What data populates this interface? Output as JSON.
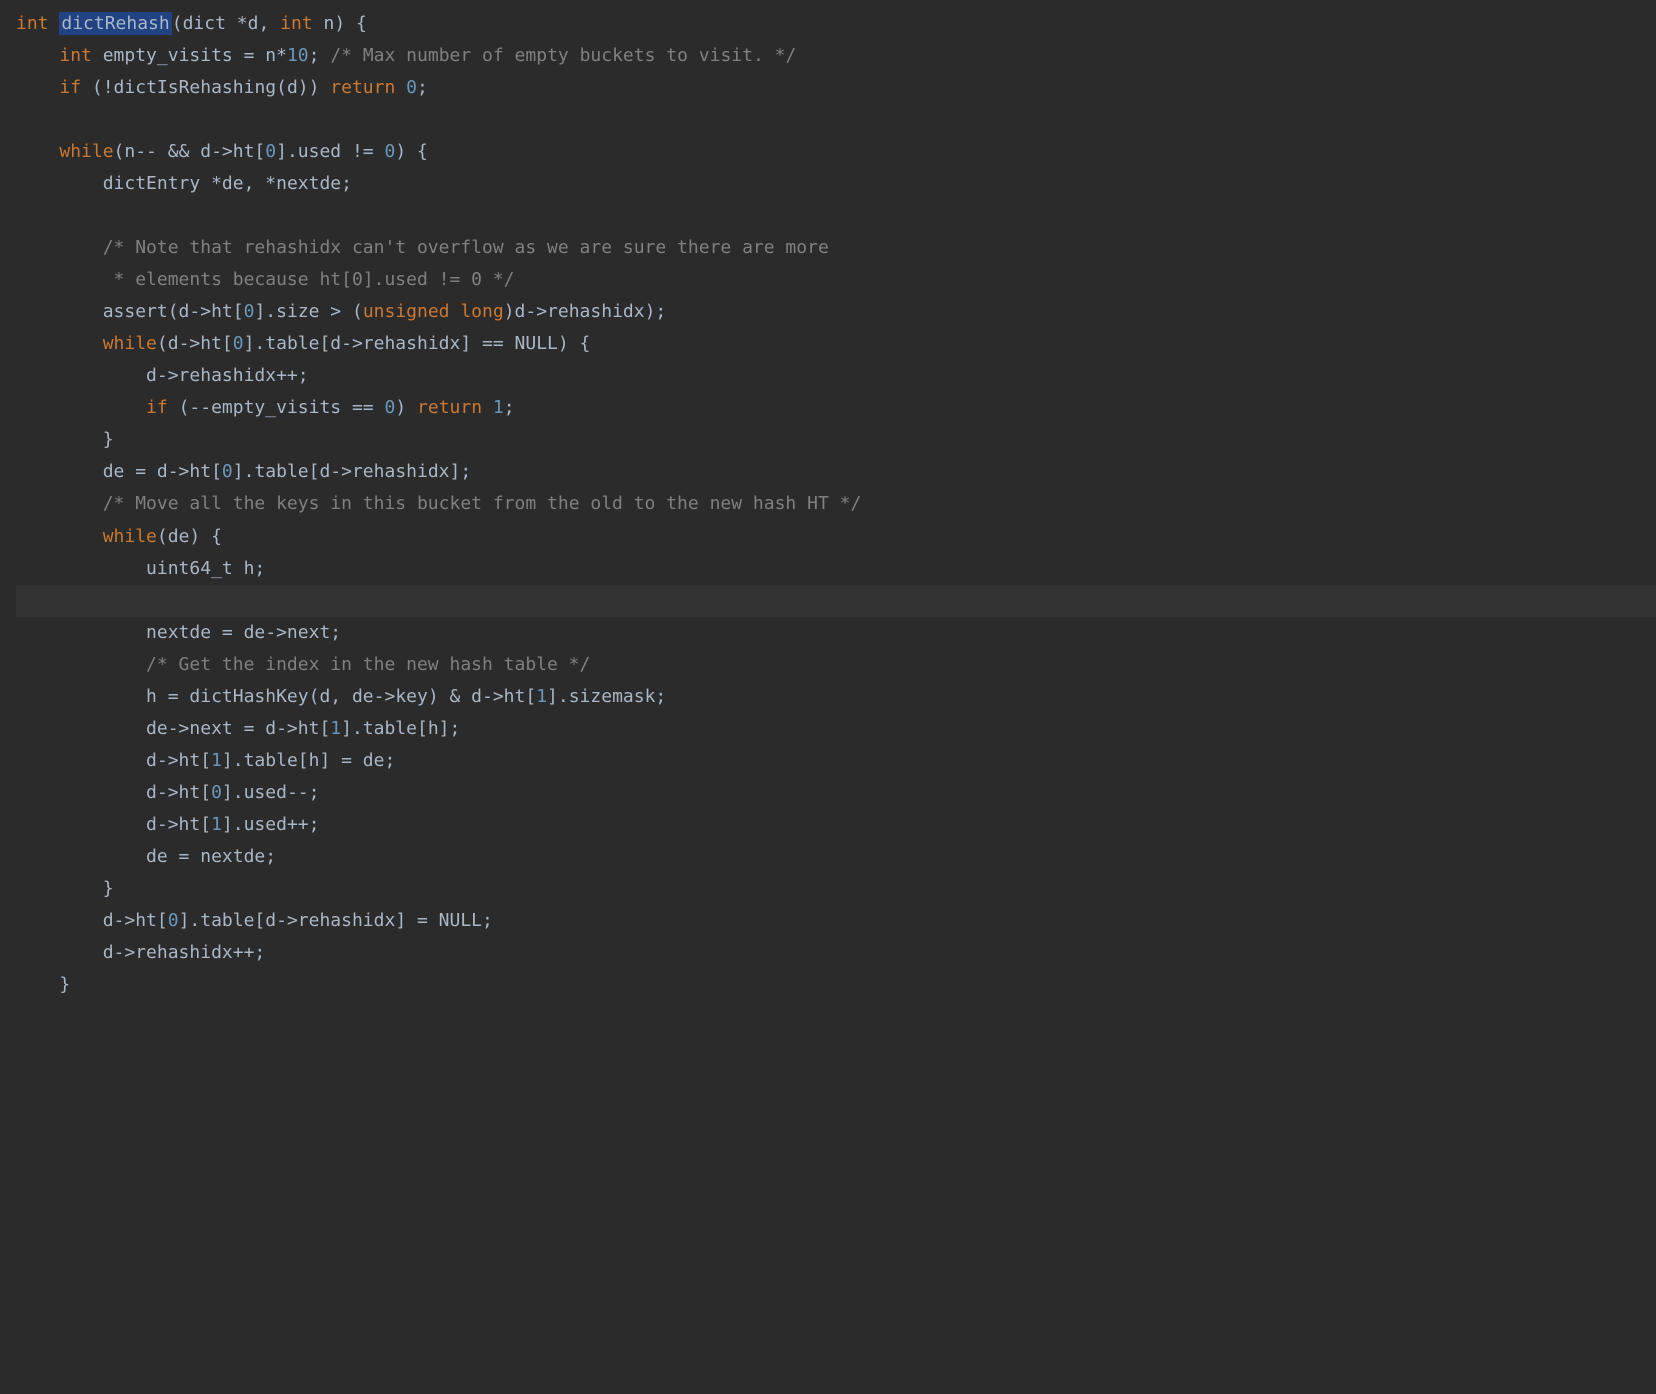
{
  "code": {
    "lines": [
      {
        "indent": 0,
        "spans": [
          {
            "cls": "kw",
            "text": "int"
          },
          {
            "cls": "white",
            "text": " "
          },
          {
            "cls": "highlight-box",
            "text": "dictRehash"
          },
          {
            "cls": "white",
            "text": "(dict *d"
          },
          {
            "cls": "op",
            "text": ", "
          },
          {
            "cls": "kw",
            "text": "int"
          },
          {
            "cls": "white",
            "text": " n) {"
          }
        ]
      },
      {
        "indent": 1,
        "spans": [
          {
            "cls": "kw",
            "text": "int"
          },
          {
            "cls": "white",
            "text": " empty_visits = n*"
          },
          {
            "cls": "num",
            "text": "10"
          },
          {
            "cls": "white",
            "text": "; "
          },
          {
            "cls": "comment",
            "text": "/* Max number of empty buckets to visit. */"
          }
        ]
      },
      {
        "indent": 1,
        "spans": [
          {
            "cls": "kw",
            "text": "if"
          },
          {
            "cls": "white",
            "text": " (!dictIsRehashing(d)) "
          },
          {
            "cls": "kw",
            "text": "return"
          },
          {
            "cls": "white",
            "text": " "
          },
          {
            "cls": "num",
            "text": "0"
          },
          {
            "cls": "white",
            "text": ";"
          }
        ]
      },
      {
        "indent": 0,
        "spans": []
      },
      {
        "indent": 1,
        "spans": [
          {
            "cls": "kw",
            "text": "while"
          },
          {
            "cls": "white",
            "text": "(n-- && d->ht["
          },
          {
            "cls": "num",
            "text": "0"
          },
          {
            "cls": "white",
            "text": "].used != "
          },
          {
            "cls": "num",
            "text": "0"
          },
          {
            "cls": "white",
            "text": ") {"
          }
        ]
      },
      {
        "indent": 2,
        "spans": [
          {
            "cls": "white",
            "text": "dictEntry *de"
          },
          {
            "cls": "op",
            "text": ", "
          },
          {
            "cls": "white",
            "text": "*nextde;"
          }
        ]
      },
      {
        "indent": 0,
        "spans": []
      },
      {
        "indent": 2,
        "spans": [
          {
            "cls": "comment",
            "text": "/* Note that rehashidx can't overflow as we are sure there are more"
          }
        ]
      },
      {
        "indent": 2,
        "spans": [
          {
            "cls": "comment",
            "text": " * elements because ht[0].used != 0 */"
          }
        ]
      },
      {
        "indent": 2,
        "spans": [
          {
            "cls": "white",
            "text": "assert(d->ht["
          },
          {
            "cls": "num",
            "text": "0"
          },
          {
            "cls": "white",
            "text": "].size > ("
          },
          {
            "cls": "kw",
            "text": "unsigned long"
          },
          {
            "cls": "white",
            "text": ")d->rehashidx);"
          }
        ]
      },
      {
        "indent": 2,
        "spans": [
          {
            "cls": "kw",
            "text": "while"
          },
          {
            "cls": "white",
            "text": "(d->ht["
          },
          {
            "cls": "num",
            "text": "0"
          },
          {
            "cls": "white",
            "text": "].table[d->rehashidx] == NULL) {"
          }
        ]
      },
      {
        "indent": 3,
        "spans": [
          {
            "cls": "white",
            "text": "d->rehashidx++;"
          }
        ]
      },
      {
        "indent": 3,
        "spans": [
          {
            "cls": "kw",
            "text": "if"
          },
          {
            "cls": "white",
            "text": " (--empty_visits == "
          },
          {
            "cls": "num",
            "text": "0"
          },
          {
            "cls": "white",
            "text": ") "
          },
          {
            "cls": "kw",
            "text": "return"
          },
          {
            "cls": "white",
            "text": " "
          },
          {
            "cls": "num",
            "text": "1"
          },
          {
            "cls": "white",
            "text": ";"
          }
        ]
      },
      {
        "indent": 2,
        "spans": [
          {
            "cls": "white",
            "text": "}"
          }
        ]
      },
      {
        "indent": 2,
        "spans": [
          {
            "cls": "white",
            "text": "de = d->ht["
          },
          {
            "cls": "num",
            "text": "0"
          },
          {
            "cls": "white",
            "text": "].table[d->rehashidx];"
          }
        ]
      },
      {
        "indent": 2,
        "spans": [
          {
            "cls": "comment",
            "text": "/* Move all the keys in this bucket from the old to the new hash HT */"
          }
        ]
      },
      {
        "indent": 2,
        "spans": [
          {
            "cls": "kw",
            "text": "while"
          },
          {
            "cls": "white",
            "text": "(de) {"
          }
        ]
      },
      {
        "indent": 3,
        "spans": [
          {
            "cls": "white",
            "text": "uint64_t h;"
          }
        ]
      },
      {
        "indent": 0,
        "spans": [],
        "highlighted": true
      },
      {
        "indent": 3,
        "spans": [
          {
            "cls": "white",
            "text": "nextde = de->next;"
          }
        ]
      },
      {
        "indent": 3,
        "spans": [
          {
            "cls": "comment",
            "text": "/* Get the index in the new hash table */"
          }
        ]
      },
      {
        "indent": 3,
        "spans": [
          {
            "cls": "white",
            "text": "h = dictHashKey(d"
          },
          {
            "cls": "op",
            "text": ", "
          },
          {
            "cls": "white",
            "text": "de->key) & d->ht["
          },
          {
            "cls": "num",
            "text": "1"
          },
          {
            "cls": "white",
            "text": "].sizemask;"
          }
        ]
      },
      {
        "indent": 3,
        "spans": [
          {
            "cls": "white",
            "text": "de->next = d->ht["
          },
          {
            "cls": "num",
            "text": "1"
          },
          {
            "cls": "white",
            "text": "].table[h];"
          }
        ]
      },
      {
        "indent": 3,
        "spans": [
          {
            "cls": "white",
            "text": "d->ht["
          },
          {
            "cls": "num",
            "text": "1"
          },
          {
            "cls": "white",
            "text": "].table[h] = de;"
          }
        ]
      },
      {
        "indent": 3,
        "spans": [
          {
            "cls": "white",
            "text": "d->ht["
          },
          {
            "cls": "num",
            "text": "0"
          },
          {
            "cls": "white",
            "text": "].used--;"
          }
        ]
      },
      {
        "indent": 3,
        "spans": [
          {
            "cls": "white",
            "text": "d->ht["
          },
          {
            "cls": "num",
            "text": "1"
          },
          {
            "cls": "white",
            "text": "].used++;"
          }
        ]
      },
      {
        "indent": 3,
        "spans": [
          {
            "cls": "white",
            "text": "de = nextde;"
          }
        ]
      },
      {
        "indent": 2,
        "spans": [
          {
            "cls": "white",
            "text": "}"
          }
        ]
      },
      {
        "indent": 2,
        "spans": [
          {
            "cls": "white",
            "text": "d->ht["
          },
          {
            "cls": "num",
            "text": "0"
          },
          {
            "cls": "white",
            "text": "].table[d->rehashidx] = NULL;"
          }
        ]
      },
      {
        "indent": 2,
        "spans": [
          {
            "cls": "white",
            "text": "d->rehashidx++;"
          }
        ]
      },
      {
        "indent": 1,
        "spans": [
          {
            "cls": "white",
            "text": "}"
          }
        ]
      }
    ]
  }
}
